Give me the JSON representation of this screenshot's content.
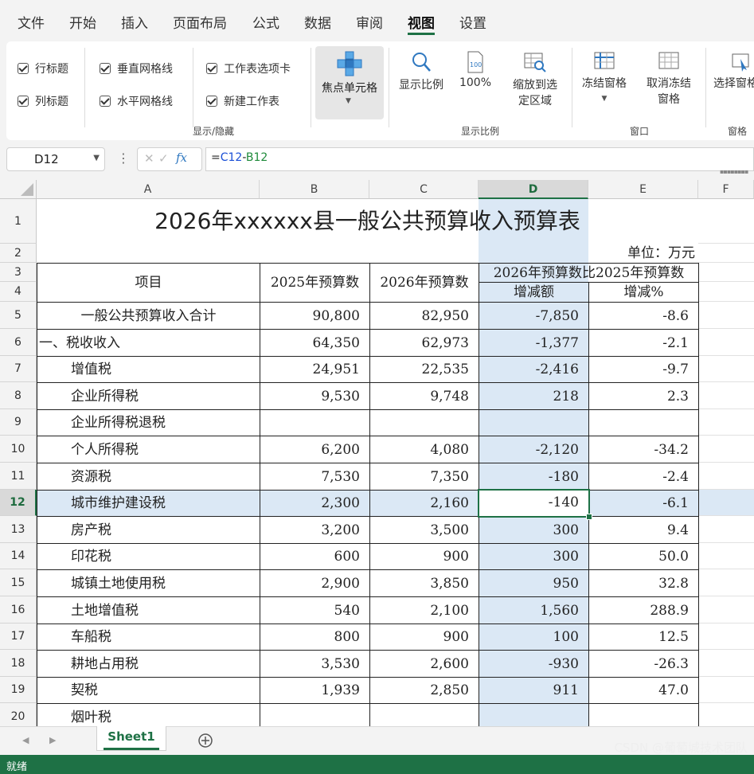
{
  "menu": {
    "items": [
      "文件",
      "开始",
      "插入",
      "页面布局",
      "公式",
      "数据",
      "审阅",
      "视图",
      "设置"
    ],
    "active": "视图"
  },
  "ribbon": {
    "checks": {
      "row_heading": "行标题",
      "col_heading": "列标题",
      "vertical_grid": "垂直网格线",
      "horizontal_grid": "水平网格线",
      "sheet_tabs": "工作表选项卡",
      "new_sheet": "新建工作表"
    },
    "focus_cell": "焦点单元格",
    "group_show_hide": "显示/隐藏",
    "zoom": "显示比例",
    "zoom_100": "100%",
    "zoom_selection_1": "缩放到选",
    "zoom_selection_2": "定区域",
    "group_zoom": "显示比例",
    "freeze": "冻结窗格",
    "unfreeze_1": "取消冻结",
    "unfreeze_2": "窗格",
    "group_window": "窗口",
    "select_pane": "选择窗格",
    "group_pane": "窗格"
  },
  "formula": {
    "name_box": "D12",
    "fx": "fx",
    "text_prefix": "=",
    "ref1": "C12",
    "op": "-",
    "ref2": "B12",
    "ref1_color": "#1a4fd6",
    "ref2_color": "#1e8a3a"
  },
  "columns": [
    "A",
    "B",
    "C",
    "D",
    "E",
    "F"
  ],
  "selected_col": "D",
  "selected_row": "12",
  "sheet": {
    "title": "2026年xxxxxx县一般公共预算收入预算表",
    "unit": "单位：万元",
    "h_item": "项目",
    "h_2025": "2025年预算数",
    "h_2026": "2026年预算数",
    "h_compare": "2026年预算数比2025年预算数",
    "h_diff": "增减额",
    "h_pct": "增减%",
    "rows": [
      {
        "r": "5",
        "a": "一般公共预算收入合计",
        "b": "90,800",
        "c": "82,950",
        "d": "-7,850",
        "e": "-8.6",
        "indent": "center"
      },
      {
        "r": "6",
        "a": "一、税收收入",
        "b": "64,350",
        "c": "62,973",
        "d": "-1,377",
        "e": "-2.1",
        "indent": "none"
      },
      {
        "r": "7",
        "a": "增值税",
        "b": "24,951",
        "c": "22,535",
        "d": "-2,416",
        "e": "-9.7",
        "indent": "sub"
      },
      {
        "r": "8",
        "a": "企业所得税",
        "b": "9,530",
        "c": "9,748",
        "d": "218",
        "e": "2.3",
        "indent": "sub"
      },
      {
        "r": "9",
        "a": "企业所得税退税",
        "b": "",
        "c": "",
        "d": "",
        "e": "",
        "indent": "sub"
      },
      {
        "r": "10",
        "a": "个人所得税",
        "b": "6,200",
        "c": "4,080",
        "d": "-2,120",
        "e": "-34.2",
        "indent": "sub"
      },
      {
        "r": "11",
        "a": "资源税",
        "b": "7,530",
        "c": "7,350",
        "d": "-180",
        "e": "-2.4",
        "indent": "sub"
      },
      {
        "r": "12",
        "a": "城市维护建设税",
        "b": "2,300",
        "c": "2,160",
        "d": "-140",
        "e": "-6.1",
        "indent": "sub"
      },
      {
        "r": "13",
        "a": "房产税",
        "b": "3,200",
        "c": "3,500",
        "d": "300",
        "e": "9.4",
        "indent": "sub"
      },
      {
        "r": "14",
        "a": "印花税",
        "b": "600",
        "c": "900",
        "d": "300",
        "e": "50.0",
        "indent": "sub"
      },
      {
        "r": "15",
        "a": "城镇土地使用税",
        "b": "2,900",
        "c": "3,850",
        "d": "950",
        "e": "32.8",
        "indent": "sub"
      },
      {
        "r": "16",
        "a": "土地增值税",
        "b": "540",
        "c": "2,100",
        "d": "1,560",
        "e": "288.9",
        "indent": "sub"
      },
      {
        "r": "17",
        "a": "车船税",
        "b": "800",
        "c": "900",
        "d": "100",
        "e": "12.5",
        "indent": "sub"
      },
      {
        "r": "18",
        "a": "耕地占用税",
        "b": "3,530",
        "c": "2,600",
        "d": "-930",
        "e": "-26.3",
        "indent": "sub"
      },
      {
        "r": "19",
        "a": "契税",
        "b": "1,939",
        "c": "2,850",
        "d": "911",
        "e": "47.0",
        "indent": "sub"
      },
      {
        "r": "20",
        "a": "烟叶税",
        "b": "",
        "c": "",
        "d": "",
        "e": "",
        "indent": "sub"
      }
    ]
  },
  "tabs": {
    "sheet1": "Sheet1"
  },
  "status": {
    "ready": "就绪",
    "watermark": "CSDN @葡萄城技术团队"
  },
  "colors": {
    "accent": "#1e7145",
    "selection": "#dbe8f5"
  }
}
